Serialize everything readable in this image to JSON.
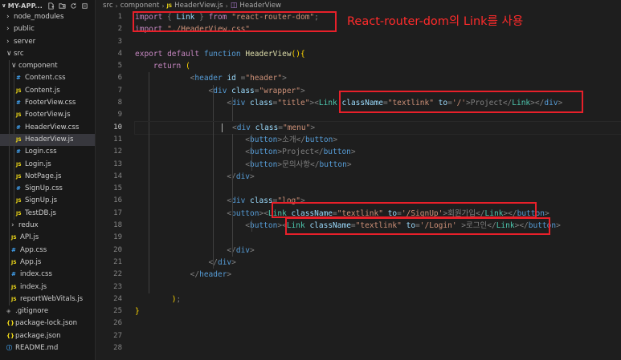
{
  "explorer": {
    "project_title": "MY-APP...",
    "items": [
      {
        "label": "node_modules",
        "kind": "folder",
        "depth": 1,
        "open": false
      },
      {
        "label": "public",
        "kind": "folder",
        "depth": 1,
        "open": false
      },
      {
        "label": "server",
        "kind": "folder",
        "depth": 1,
        "open": false
      },
      {
        "label": "src",
        "kind": "folder",
        "depth": 1,
        "open": true
      },
      {
        "label": "component",
        "kind": "folder",
        "depth": 2,
        "open": true
      },
      {
        "label": "Content.css",
        "kind": "css",
        "depth": 3
      },
      {
        "label": "Content.js",
        "kind": "js",
        "depth": 3
      },
      {
        "label": "FooterView.css",
        "kind": "css",
        "depth": 3
      },
      {
        "label": "FooterView.js",
        "kind": "js",
        "depth": 3
      },
      {
        "label": "HeaderView.css",
        "kind": "css",
        "depth": 3
      },
      {
        "label": "HeaderView.js",
        "kind": "js",
        "depth": 3,
        "selected": true
      },
      {
        "label": "Login.css",
        "kind": "css",
        "depth": 3
      },
      {
        "label": "Login.js",
        "kind": "js",
        "depth": 3
      },
      {
        "label": "NotPage.js",
        "kind": "js",
        "depth": 3
      },
      {
        "label": "SignUp.css",
        "kind": "css",
        "depth": 3
      },
      {
        "label": "SignUp.js",
        "kind": "js",
        "depth": 3
      },
      {
        "label": "TestDB.js",
        "kind": "js",
        "depth": 3
      },
      {
        "label": "redux",
        "kind": "folder",
        "depth": 2,
        "open": false
      },
      {
        "label": "API.js",
        "kind": "js",
        "depth": 2
      },
      {
        "label": "App.css",
        "kind": "css",
        "depth": 2
      },
      {
        "label": "App.js",
        "kind": "js",
        "depth": 2
      },
      {
        "label": "index.css",
        "kind": "css",
        "depth": 2
      },
      {
        "label": "index.js",
        "kind": "js",
        "depth": 2
      },
      {
        "label": "reportWebVitals.js",
        "kind": "js",
        "depth": 2
      },
      {
        "label": ".gitignore",
        "kind": "git",
        "depth": 1
      },
      {
        "label": "package-lock.json",
        "kind": "json",
        "depth": 1
      },
      {
        "label": "package.json",
        "kind": "json",
        "depth": 1
      },
      {
        "label": "README.md",
        "kind": "info",
        "depth": 1
      }
    ]
  },
  "breadcrumb": {
    "folder1": "src",
    "folder2": "component",
    "file": "HeaderView.js",
    "symbol": "HeaderView"
  },
  "editor": {
    "active_line": 10,
    "line_numbers": [
      "1",
      "2",
      "3",
      "4",
      "5",
      "6",
      "7",
      "8",
      "9",
      "10",
      "11",
      "12",
      "13",
      "14",
      "15",
      "16",
      "17",
      "18",
      "19",
      "20",
      "21",
      "22",
      "23",
      "24",
      "25",
      "26",
      "27",
      "28"
    ],
    "lines": [
      {
        "guides": [],
        "tokens": [
          [
            "kw",
            "import"
          ],
          [
            "pn",
            " { "
          ],
          [
            "vr",
            "Link"
          ],
          [
            "pn",
            " } "
          ],
          [
            "kw",
            "from"
          ],
          [
            "pn",
            " "
          ],
          [
            "st",
            "\"react-router-dom\""
          ],
          [
            "pn",
            ";"
          ]
        ]
      },
      {
        "guides": [],
        "tokens": [
          [
            "kw",
            "import"
          ],
          [
            "pn",
            " "
          ],
          [
            "st",
            "\"./HeaderView.css\""
          ]
        ]
      },
      {
        "guides": [],
        "tokens": []
      },
      {
        "guides": [],
        "tokens": [
          [
            "kw",
            "export"
          ],
          [
            "pn",
            " "
          ],
          [
            "kw",
            "default"
          ],
          [
            "pn",
            " "
          ],
          [
            "df",
            "function"
          ],
          [
            "pn",
            " "
          ],
          [
            "fn",
            "HeaderView"
          ],
          [
            "br",
            "()"
          ],
          [
            "br",
            "{"
          ]
        ]
      },
      {
        "guides": [],
        "tokens": [
          [
            "pn",
            "    "
          ],
          [
            "kw",
            "return"
          ],
          [
            "pn",
            " "
          ],
          [
            "br",
            "("
          ]
        ]
      },
      {
        "guides": [
          1
        ],
        "tokens": [
          [
            "pn",
            "            "
          ],
          [
            "pn",
            "<"
          ],
          [
            "tg",
            "header"
          ],
          [
            "pn",
            " "
          ],
          [
            "vr",
            "id"
          ],
          [
            "pn",
            " ="
          ],
          [
            "st",
            "\"header\""
          ],
          [
            "pn",
            ">"
          ]
        ]
      },
      {
        "guides": [
          1,
          3
        ],
        "tokens": [
          [
            "pn",
            "                "
          ],
          [
            "pn",
            "<"
          ],
          [
            "tg",
            "div"
          ],
          [
            "pn",
            " "
          ],
          [
            "vr",
            "class"
          ],
          [
            "pn",
            "="
          ],
          [
            "st",
            "\"wrapper\""
          ],
          [
            "pn",
            ">"
          ]
        ]
      },
      {
        "guides": [
          1,
          3,
          4
        ],
        "tokens": [
          [
            "pn",
            "                    "
          ],
          [
            "pn",
            "<"
          ],
          [
            "tg",
            "div"
          ],
          [
            "pn",
            " "
          ],
          [
            "vr",
            "class"
          ],
          [
            "pn",
            "="
          ],
          [
            "st",
            "\"title\""
          ],
          [
            "pn",
            ">"
          ],
          [
            "pn",
            "<"
          ],
          [
            "ty",
            "Link"
          ],
          [
            "pn",
            " "
          ],
          [
            "vr",
            "className"
          ],
          [
            "pn",
            "="
          ],
          [
            "st",
            "\"textlink\""
          ],
          [
            "pn",
            " "
          ],
          [
            "vr",
            "to"
          ],
          [
            "pn",
            "="
          ],
          [
            "st",
            "'/'"
          ],
          [
            "pn",
            ">"
          ],
          [
            "pn",
            "Project"
          ],
          [
            "pn",
            "</"
          ],
          [
            "ty",
            "Link"
          ],
          [
            "pn",
            ">"
          ],
          [
            "pn",
            "</"
          ],
          [
            "tg",
            "div"
          ],
          [
            "pn",
            ">"
          ]
        ]
      },
      {
        "guides": [
          1,
          3,
          4
        ],
        "tokens": []
      },
      {
        "guides": [
          1,
          3
        ],
        "cursor": true,
        "tokens": [
          [
            "pn",
            "<"
          ],
          [
            "tg",
            "div"
          ],
          [
            "pn",
            " "
          ],
          [
            "vr",
            "class"
          ],
          [
            "pn",
            "="
          ],
          [
            "st",
            "\"menu\""
          ],
          [
            "pn",
            ">"
          ]
        ]
      },
      {
        "guides": [
          1,
          3,
          4,
          5
        ],
        "tokens": [
          [
            "pn",
            "                        "
          ],
          [
            "pn",
            "<"
          ],
          [
            "tg",
            "button"
          ],
          [
            "pn",
            ">"
          ],
          [
            "pn",
            "소개"
          ],
          [
            "pn",
            "</"
          ],
          [
            "tg",
            "button"
          ],
          [
            "pn",
            ">"
          ]
        ]
      },
      {
        "guides": [
          1,
          3,
          4,
          5
        ],
        "tokens": [
          [
            "pn",
            "                        "
          ],
          [
            "pn",
            "<"
          ],
          [
            "tg",
            "button"
          ],
          [
            "pn",
            ">"
          ],
          [
            "pn",
            "Project"
          ],
          [
            "pn",
            "</"
          ],
          [
            "tg",
            "button"
          ],
          [
            "pn",
            ">"
          ]
        ]
      },
      {
        "guides": [
          1,
          3,
          4,
          5
        ],
        "tokens": [
          [
            "pn",
            "                        "
          ],
          [
            "pn",
            "<"
          ],
          [
            "tg",
            "button"
          ],
          [
            "pn",
            ">"
          ],
          [
            "pn",
            "문의사항"
          ],
          [
            "pn",
            "</"
          ],
          [
            "tg",
            "button"
          ],
          [
            "pn",
            ">"
          ]
        ]
      },
      {
        "guides": [
          1,
          3,
          4
        ],
        "tokens": [
          [
            "pn",
            "                    "
          ],
          [
            "pn",
            "</"
          ],
          [
            "tg",
            "div"
          ],
          [
            "pn",
            ">"
          ]
        ]
      },
      {
        "guides": [
          1,
          3,
          4
        ],
        "tokens": []
      },
      {
        "guides": [
          1,
          3,
          4
        ],
        "tokens": [
          [
            "pn",
            "                    "
          ],
          [
            "pn",
            "<"
          ],
          [
            "tg",
            "div"
          ],
          [
            "pn",
            " "
          ],
          [
            "vr",
            "class"
          ],
          [
            "pn",
            "="
          ],
          [
            "st",
            "\"log\""
          ],
          [
            "pn",
            ">"
          ]
        ]
      },
      {
        "guides": [
          1,
          3,
          4
        ],
        "tokens": [
          [
            "pn",
            "                    "
          ],
          [
            "pn",
            "<"
          ],
          [
            "tg",
            "button"
          ],
          [
            "pn",
            ">"
          ],
          [
            "pn",
            "<"
          ],
          [
            "ty",
            "Link"
          ],
          [
            "pn",
            " "
          ],
          [
            "vr",
            "className"
          ],
          [
            "pn",
            "="
          ],
          [
            "st",
            "\"textlink\""
          ],
          [
            "pn",
            " "
          ],
          [
            "vr",
            "to"
          ],
          [
            "pn",
            "="
          ],
          [
            "st",
            "'/SignUp'"
          ],
          [
            "pn",
            ">"
          ],
          [
            "pn",
            "회원가입"
          ],
          [
            "pn",
            "</"
          ],
          [
            "ty",
            "Link"
          ],
          [
            "pn",
            ">"
          ],
          [
            "pn",
            "</"
          ],
          [
            "tg",
            "button"
          ],
          [
            "pn",
            ">"
          ]
        ]
      },
      {
        "guides": [
          1,
          3,
          4,
          5
        ],
        "tokens": [
          [
            "pn",
            "                        "
          ],
          [
            "pn",
            "<"
          ],
          [
            "tg",
            "button"
          ],
          [
            "pn",
            ">"
          ],
          [
            "pn",
            "<"
          ],
          [
            "ty",
            "Link"
          ],
          [
            "pn",
            " "
          ],
          [
            "vr",
            "className"
          ],
          [
            "pn",
            "="
          ],
          [
            "st",
            "\"textlink\""
          ],
          [
            "pn",
            " "
          ],
          [
            "vr",
            "to"
          ],
          [
            "pn",
            "="
          ],
          [
            "st",
            "'/Login'"
          ],
          [
            "pn",
            " >"
          ],
          [
            "pn",
            "로그인"
          ],
          [
            "pn",
            "</"
          ],
          [
            "ty",
            "Link"
          ],
          [
            "pn",
            ">"
          ],
          [
            "pn",
            "</"
          ],
          [
            "tg",
            "button"
          ],
          [
            "pn",
            ">"
          ]
        ]
      },
      {
        "guides": [
          1,
          3,
          4
        ],
        "tokens": []
      },
      {
        "guides": [
          1,
          3,
          4
        ],
        "tokens": [
          [
            "pn",
            "                    "
          ],
          [
            "pn",
            "</"
          ],
          [
            "tg",
            "div"
          ],
          [
            "pn",
            ">"
          ]
        ]
      },
      {
        "guides": [
          1,
          3
        ],
        "tokens": [
          [
            "pn",
            "                "
          ],
          [
            "pn",
            "</"
          ],
          [
            "tg",
            "div"
          ],
          [
            "pn",
            ">"
          ]
        ]
      },
      {
        "guides": [
          1
        ],
        "tokens": [
          [
            "pn",
            "            "
          ],
          [
            "pn",
            "</"
          ],
          [
            "tg",
            "header"
          ],
          [
            "pn",
            ">"
          ]
        ]
      },
      {
        "guides": [
          1
        ],
        "tokens": []
      },
      {
        "guides": [],
        "tokens": [
          [
            "pn",
            "        "
          ],
          [
            "br",
            ")"
          ],
          [
            "pn",
            ";"
          ]
        ]
      },
      {
        "guides": [],
        "tokens": [
          [
            "br",
            "}"
          ]
        ]
      },
      {
        "guides": [],
        "tokens": []
      },
      {
        "guides": [],
        "tokens": []
      },
      {
        "guides": [],
        "tokens": []
      }
    ]
  },
  "annotation": {
    "text": "React-router-dom의 Link를 사용",
    "color": "#e8202a"
  }
}
